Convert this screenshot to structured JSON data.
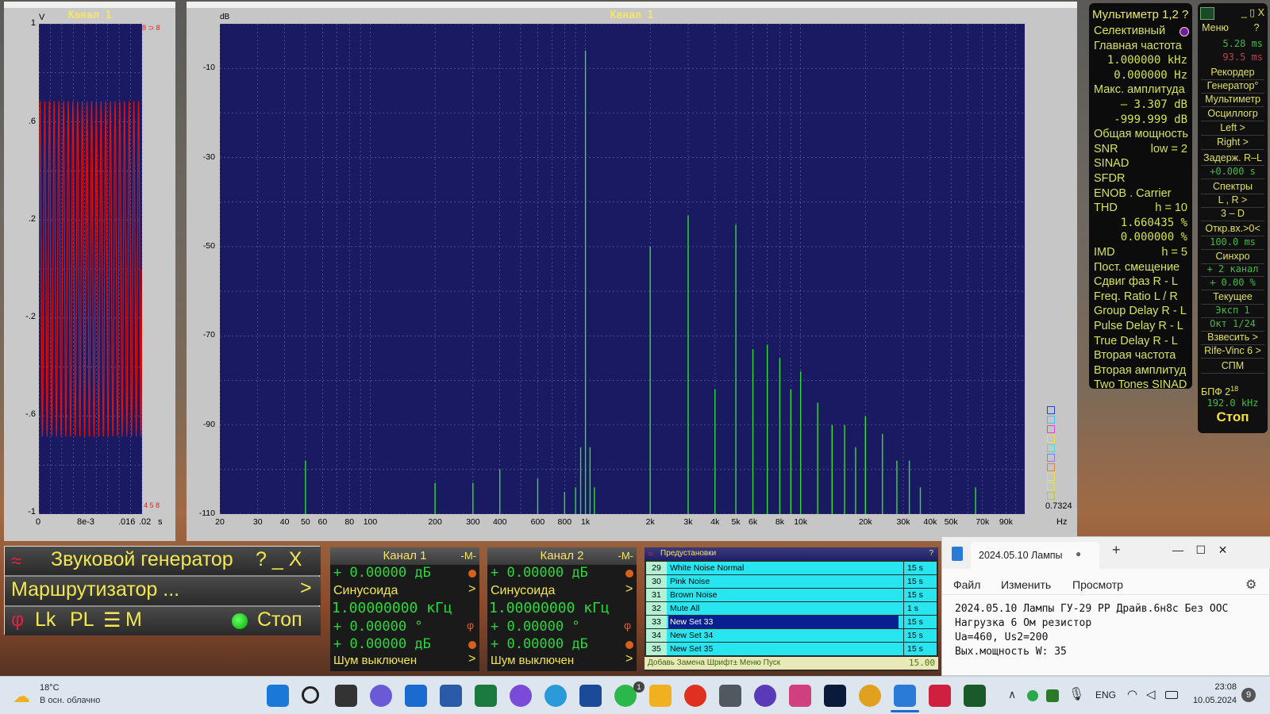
{
  "oscilloscope": {
    "title": "Канал 1",
    "y_unit": "V",
    "y_ticks": [
      "1",
      ".6",
      ".2",
      "-.2",
      "-.6",
      "-1"
    ],
    "x_ticks": [
      "0",
      "8e-3",
      ".016",
      ".02"
    ],
    "x_unit": "s",
    "corner_top": "8 ⊃ 8",
    "corner_bottom": "4 5 8"
  },
  "spectrum": {
    "title": "Канал 1",
    "y_unit": "dB",
    "y_ticks": [
      "-10",
      "-30",
      "-50",
      "-70",
      "-90",
      "-110"
    ],
    "x_ticks": [
      "20",
      "30",
      "40",
      "50",
      "60",
      "80",
      "100",
      "200",
      "300",
      "400",
      "600",
      "800",
      "1k",
      "2k",
      "3k",
      "4k",
      "5k",
      "6k",
      "8k",
      "10k",
      "20k",
      "30k",
      "40k",
      "50k",
      "70k",
      "90k"
    ],
    "x_unit": "Hz",
    "corner_value": "0.7324"
  },
  "chart_data": {
    "type": "line",
    "title": "Канал 1",
    "xlabel": "Hz",
    "ylabel": "dB",
    "x_scale": "log",
    "xlim": [
      20,
      110000
    ],
    "ylim": [
      -110,
      0
    ],
    "grid": true,
    "series": [
      {
        "x": [
          50,
          200,
          300,
          400,
          600,
          800,
          900,
          950,
          1000,
          1050,
          1100,
          2000,
          3000,
          4000,
          5000,
          6000,
          7000,
          8000,
          9000,
          10000,
          12000,
          14000,
          16000,
          18000,
          20000,
          24000,
          28000,
          32000,
          36000,
          65000
        ],
        "y": [
          -98,
          -103,
          -103,
          -100,
          -102,
          -105,
          -104,
          -95,
          -6,
          -95,
          -104,
          -50,
          -43,
          -82,
          -45,
          -73,
          -72,
          -75,
          -82,
          -78,
          -85,
          -90,
          -90,
          -95,
          -88,
          -92,
          -98,
          -98,
          -104,
          -104
        ]
      }
    ]
  },
  "multimeter": {
    "title": "Мультиметр 1,2 ?",
    "rows": [
      {
        "label": "Селективный",
        "value": ""
      },
      {
        "label": "Главная частота",
        "value": ""
      },
      {
        "label": "",
        "value": "1.000000 kHz"
      },
      {
        "label": "",
        "value": "0.000000  Hz"
      },
      {
        "label": "Макс. амплитуда",
        "value": ""
      },
      {
        "label": "",
        "value": "–   3.307 dB"
      },
      {
        "label": "",
        "value": "-999.999 dB"
      },
      {
        "label": "Общая мощность",
        "value": ""
      },
      {
        "label": "SNR",
        "value": "low =  2"
      },
      {
        "label": "SINAD",
        "value": ""
      },
      {
        "label": "SFDR",
        "value": ""
      },
      {
        "label": "ENOB . Carrier",
        "value": ""
      },
      {
        "label": "THD",
        "value": "h = 10"
      },
      {
        "label": "",
        "value": "1.660435 %"
      },
      {
        "label": "",
        "value": "0.000000 %"
      },
      {
        "label": "IMD",
        "value": "h =  5"
      },
      {
        "label": "Пост. смещение",
        "value": ""
      },
      {
        "label": "Сдвиг фаз R - L",
        "value": ""
      },
      {
        "label": "Freq. Ratio  L / R",
        "value": ""
      },
      {
        "label": "Group Delay R - L",
        "value": ""
      },
      {
        "label": "Pulse Delay R - L",
        "value": ""
      },
      {
        "label": "True Delay R - L",
        "value": ""
      },
      {
        "label": "Вторая частота",
        "value": ""
      },
      {
        "label": "Вторая амплитуд",
        "value": ""
      },
      {
        "label": "Two Tones SINAD",
        "value": ""
      }
    ]
  },
  "side_menu": {
    "title_controls": "_ ▯ X",
    "menu_label": "Меню",
    "help": "?",
    "time1": "5.28 ms",
    "time2": "93.5 ms",
    "items": [
      "Рекордер",
      "Генератор°",
      "Мультиметр",
      "Осциллогр",
      "Left   >",
      "Right   >",
      "Задерж. R–L",
      "+0.000  s",
      "Спектры",
      "L , R    >",
      "3 – D",
      "Откр.вх.>0<",
      "100.0 ms",
      "Синхро",
      "+ 2 канал",
      "+ 0.00 %",
      "Текущее",
      "Эксп     1",
      "Окт  1/24",
      "Взвесить  >",
      "Rife-Vinc 6 >",
      "СПМ"
    ],
    "fft_label": "БПФ   2",
    "fft_exp": "18",
    "fft_rate": "192.0 kHz",
    "stop": "Стоп"
  },
  "generator": {
    "title": "Звуковой генератор",
    "title_btns": "?  _  X",
    "router": "Маршрутизатор ...",
    "router_arrow": ">",
    "phi": "φ",
    "lk": "Lk",
    "pl": "PL",
    "eq": "☰",
    "m": "M",
    "stop": "Стоп"
  },
  "channels": [
    {
      "title": "Канал 1",
      "badge": "-M-",
      "level": "+   0.00000 дБ",
      "wave": "Синусоида",
      "freq": "1.00000000 кГц",
      "phase": "+   0.00000 °",
      "phase_sym": "φ",
      "amp": "+   0.00000 дБ",
      "noise": "Шум выключен"
    },
    {
      "title": "Канал 2",
      "badge": "-M-",
      "level": "+   0.00000 дБ",
      "wave": "Синусоида",
      "freq": "1.00000000 кГц",
      "phase": "+   0.00000 °",
      "phase_sym": "φ",
      "amp": "+   0.00000 дБ",
      "noise": "Шум выключен"
    }
  ],
  "presets": {
    "title": "Предустановки",
    "help": "?",
    "items": [
      {
        "n": "29",
        "name": "White Noise Normal",
        "dur": "15 s"
      },
      {
        "n": "30",
        "name": "Pink Noise",
        "dur": "15 s"
      },
      {
        "n": "31",
        "name": "Brown Noise",
        "dur": "15 s"
      },
      {
        "n": "32",
        "name": "Mute All",
        "dur": "1 s"
      },
      {
        "n": "33",
        "name": "New Set 33",
        "dur": "15 s"
      },
      {
        "n": "34",
        "name": "New Set 34",
        "dur": "15 s"
      },
      {
        "n": "35",
        "name": "New Set 35",
        "dur": "15 s"
      }
    ],
    "footer": "Добавь Замена Шрифт± Меню Пуск",
    "footer_val": "15.00"
  },
  "notepad": {
    "tab_title": "2024.05.10 Лампы",
    "tab_dot": "●",
    "new_tab": "+",
    "controls": "—    ☐    ✕",
    "menu": [
      "Файл",
      "Изменить",
      "Просмотр"
    ],
    "lines": [
      "2024.05.10 Лампы ГУ-29 PP Драйв.6н8с Без ООС",
      "Нагрузка 6 Ом резистор",
      "Ua=460, Us2=200",
      "Вых.мощность W: 35"
    ]
  },
  "taskbar": {
    "temp": "18°C",
    "weather": "В осн. облачно",
    "lang": "ENG",
    "time": "23:08",
    "date": "10.05.2024",
    "badge": "9",
    "whatsapp_badge": "1",
    "chevron": "∧"
  },
  "colors": {
    "plot_bg": "#1a1a62",
    "trace_green": "#33dd33",
    "trace_red": "#e01010",
    "label_yellow": "#f2e84e"
  }
}
